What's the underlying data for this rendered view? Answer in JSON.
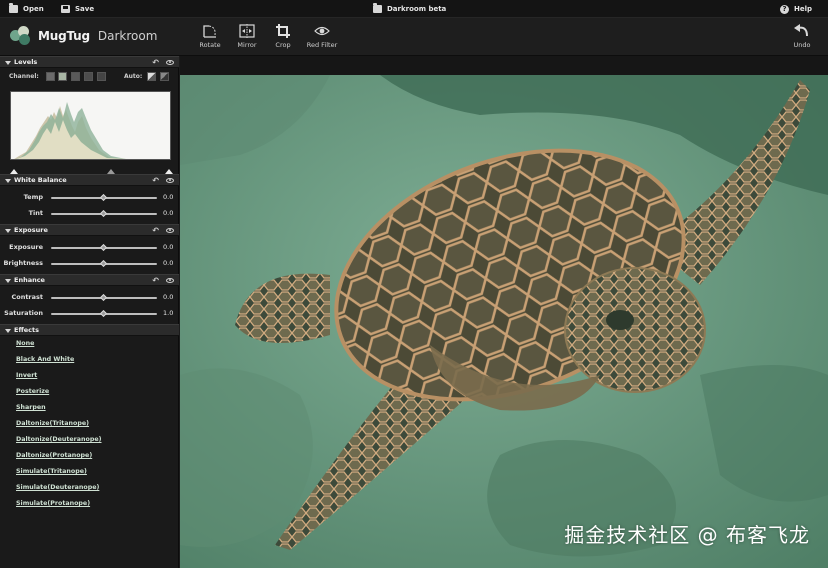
{
  "menubar": {
    "open_label": "Open",
    "save_label": "Save",
    "doc_title": "Darkroom beta",
    "help_label": "Help"
  },
  "app": {
    "name": "MugTug",
    "module": "Darkroom"
  },
  "toolbar": {
    "tools": [
      {
        "label": "Rotate",
        "icon": "rotate-icon"
      },
      {
        "label": "Mirror",
        "icon": "mirror-icon"
      },
      {
        "label": "Crop",
        "icon": "crop-icon"
      },
      {
        "label": "Red Filter",
        "icon": "eye-icon"
      }
    ],
    "undo_label": "Undo"
  },
  "levels": {
    "title": "Levels",
    "channel_label": "Channel:",
    "auto_label": "Auto:",
    "channel_colors": [
      "#6b6b6b",
      "#a7b4a3",
      "#5a5a5a",
      "#4d4d4d",
      "#444444"
    ]
  },
  "white_balance": {
    "title": "White Balance",
    "sliders": [
      {
        "label": "Temp",
        "value": "0.0",
        "level": 0.5
      },
      {
        "label": "Tint",
        "value": "0.0",
        "level": 0.5
      }
    ]
  },
  "exposure": {
    "title": "Exposure",
    "sliders": [
      {
        "label": "Exposure",
        "value": "0.0",
        "level": 0.5
      },
      {
        "label": "Brightness",
        "value": "0.0",
        "level": 0.5
      }
    ]
  },
  "enhance": {
    "title": "Enhance",
    "sliders": [
      {
        "label": "Contrast",
        "value": "0.0",
        "level": 0.5
      },
      {
        "label": "Saturation",
        "value": "1.0",
        "level": 0.5
      }
    ]
  },
  "effects": {
    "title": "Effects",
    "items": [
      "None",
      "Black And White",
      "Invert",
      "Posterize",
      "Sharpen",
      "Daltonize(Tritanope)",
      "Daltonize(Deuteranope)",
      "Daltonize(Protanope)",
      "Simulate(Tritanope)",
      "Simulate(Deuteranope)",
      "Simulate(Protanope)"
    ]
  },
  "watermark": "掘金技术社区 @ 布客飞龙",
  "colors": {
    "sidebar_bg": "#1a1a1a",
    "section_header": "#2b2b2b",
    "canvas_tint": "#6f9e86",
    "effect_link": "#cfe1d3"
  }
}
